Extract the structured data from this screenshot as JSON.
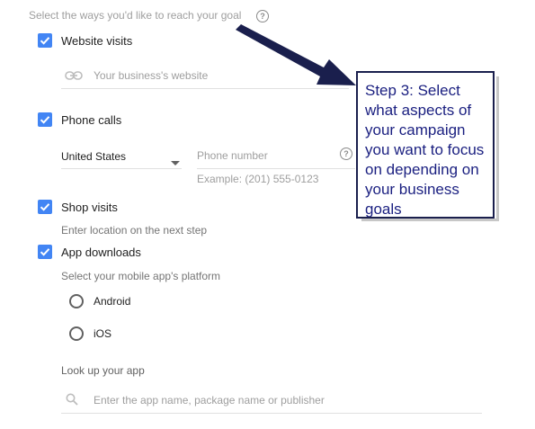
{
  "section_title": "Select the ways you'd like to reach your goal",
  "help_icon": "?",
  "website_visits": {
    "label": "Website visits",
    "checked": true,
    "placeholder": "Your business's website",
    "icon": "link-icon"
  },
  "phone_calls": {
    "label": "Phone calls",
    "checked": true,
    "country": "United States",
    "phone_placeholder": "Phone number",
    "example": "Example: (201) 555-0123"
  },
  "shop_visits": {
    "label": "Shop visits",
    "checked": true,
    "hint": "Enter location on the next step"
  },
  "app_downloads": {
    "label": "App downloads",
    "checked": true,
    "platform_prompt": "Select your mobile app's platform",
    "platforms": [
      "Android",
      "iOS"
    ],
    "lookup_label": "Look up your app",
    "search_placeholder": "Enter the app name, package name or publisher"
  },
  "callout": {
    "text": "Step 3: Select what aspects of your campaign you want to focus on depending on your business goals"
  },
  "colors": {
    "checkbox": "#4285f4",
    "callout_border": "#1a1f4d",
    "callout_text": "#1a1f80",
    "arrow": "#1a1f4d"
  }
}
